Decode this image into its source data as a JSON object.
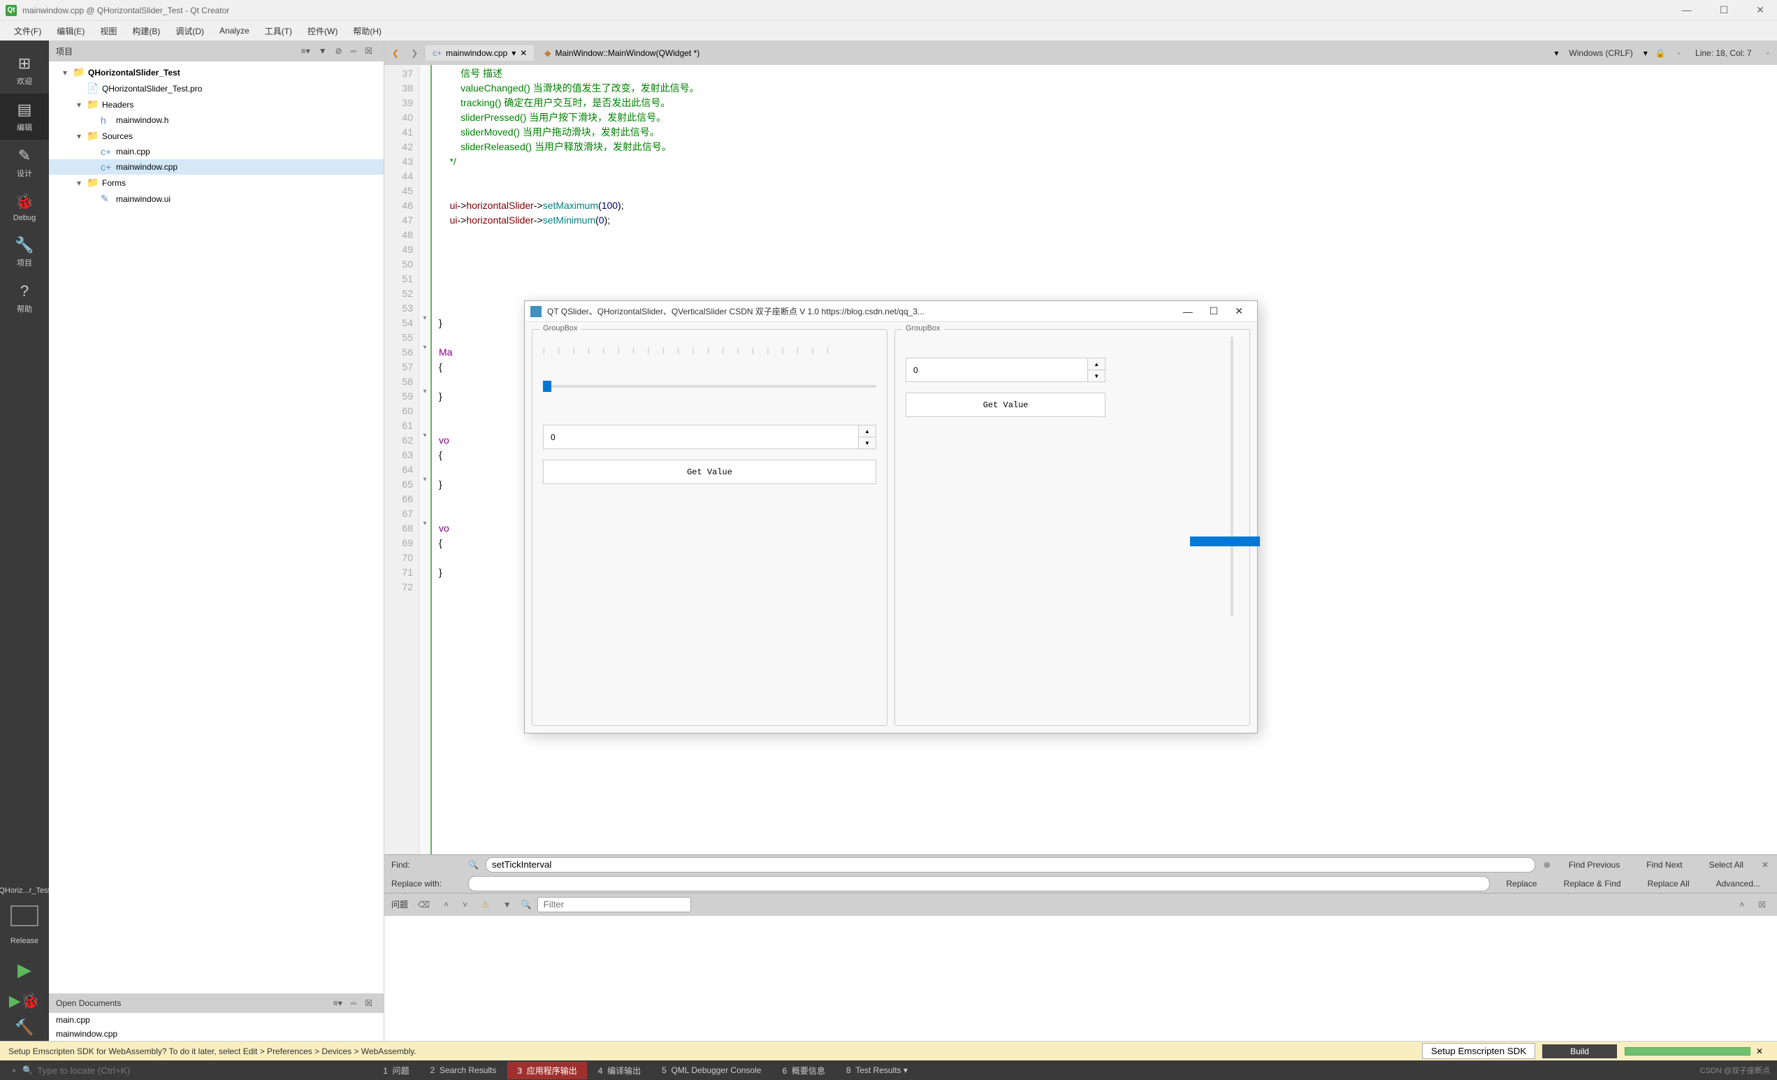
{
  "window": {
    "title": "mainwindow.cpp @ QHorizontalSlider_Test - Qt Creator",
    "minimize": "—",
    "maximize": "☐",
    "close": "✕"
  },
  "menubar": [
    "文件(F)",
    "编辑(E)",
    "视图",
    "构建(B)",
    "调试(D)",
    "Analyze",
    "工具(T)",
    "控件(W)",
    "帮助(H)"
  ],
  "sidebar": {
    "items": [
      {
        "icon": "⊞",
        "label": "欢迎"
      },
      {
        "icon": "▤",
        "label": "编辑"
      },
      {
        "icon": "✎",
        "label": "设计"
      },
      {
        "icon": "🐞",
        "label": "Debug"
      },
      {
        "icon": "🔧",
        "label": "项目"
      },
      {
        "icon": "?",
        "label": "帮助"
      }
    ],
    "kit": "QHoriz...r_Test",
    "release": "Release"
  },
  "projectPanel": {
    "title": "项目",
    "tree": {
      "root": "QHorizontalSlider_Test",
      "pro": "QHorizontalSlider_Test.pro",
      "headers": "Headers",
      "h1": "mainwindow.h",
      "sources": "Sources",
      "s1": "main.cpp",
      "s2": "mainwindow.cpp",
      "forms": "Forms",
      "f1": "mainwindow.ui"
    }
  },
  "openDocs": {
    "title": "Open Documents",
    "items": [
      "main.cpp",
      "mainwindow.cpp"
    ]
  },
  "editorTabs": {
    "file": "mainwindow.cpp",
    "symbol": "MainWindow::MainWindow(QWidget *)",
    "encoding": "Windows (CRLF)",
    "position": "Line: 18, Col: 7"
  },
  "code": {
    "startLine": 37,
    "lines": [
      "        信号 描述",
      "        valueChanged() 当滑块的值发生了改变，发射此信号。",
      "        tracking() 确定在用户交互时，是否发出此信号。",
      "        sliderPressed() 当用户按下滑块，发射此信号。",
      "        sliderMoved() 当用户拖动滑块，发射此信号。",
      "        sliderReleased() 当用户释放滑块，发射此信号。",
      "    */",
      "",
      "",
      "    ui->horizontalSlider->setMaximum(100);",
      "    ui->horizontalSlider->setMinimum(0);",
      "",
      "",
      "",
      "",
      "",
      "",
      "}",
      "",
      "Ma",
      "{",
      "",
      "}",
      "",
      "",
      "vo",
      "{",
      "",
      "}",
      "",
      "",
      "vo",
      "{",
      "",
      "}",
      ""
    ]
  },
  "dialog": {
    "title": "QT QSlider、QHorizontalSlider、QVerticalSlider CSDN 双子座断点 V 1.0 https://blog.csdn.net/qq_3...",
    "groupbox1": {
      "title": "GroupBox",
      "spinValue": "0",
      "button": "Get Value"
    },
    "groupbox2": {
      "title": "GroupBox",
      "spinValue": "0",
      "button": "Get Value"
    }
  },
  "findbar": {
    "findLabel": "Find:",
    "replaceLabel": "Replace with:",
    "findText": "setTickInterval",
    "findPrev": "Find Previous",
    "findNext": "Find Next",
    "selectAll": "Select All",
    "replace": "Replace",
    "replaceFind": "Replace & Find",
    "replaceAll": "Replace All",
    "advanced": "Advanced..."
  },
  "issues": {
    "label": "问题",
    "filterPlaceholder": "Filter"
  },
  "infobar": {
    "text": "Setup Emscripten SDK for WebAssembly? To do it later, select Edit > Preferences > Devices > WebAssembly.",
    "button": "Setup Emscripten SDK",
    "build": "Build"
  },
  "statusbar": {
    "locatePlaceholder": "Type to locate (Ctrl+K)",
    "tabs": [
      {
        "n": "1",
        "label": "问题"
      },
      {
        "n": "2",
        "label": "Search Results"
      },
      {
        "n": "3",
        "label": "应用程序输出"
      },
      {
        "n": "4",
        "label": "编译输出"
      },
      {
        "n": "5",
        "label": "QML Debugger Console"
      },
      {
        "n": "6",
        "label": "概要信息"
      },
      {
        "n": "8",
        "label": "Test Results"
      }
    ],
    "watermark": "CSDN @双子座断点"
  }
}
